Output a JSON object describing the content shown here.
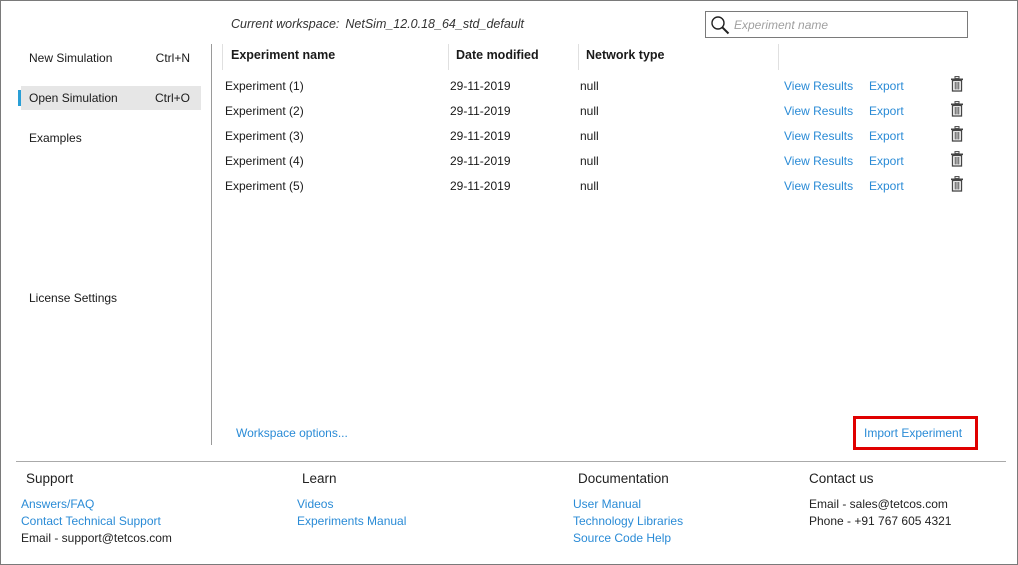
{
  "header": {
    "workspace_label": "Current workspace:",
    "workspace_name": "NetSim_12.0.18_64_std_default",
    "search_placeholder": "Experiment name",
    "search_value": ""
  },
  "sidebar": {
    "items": [
      {
        "label": "New Simulation",
        "shortcut": "Ctrl+N"
      },
      {
        "label": "Open Simulation",
        "shortcut": "Ctrl+O",
        "active": true
      },
      {
        "label": "Examples",
        "shortcut": ""
      },
      {
        "label": "License Settings",
        "shortcut": ""
      }
    ]
  },
  "table": {
    "columns": [
      "Experiment name",
      "Date modified",
      "Network type"
    ],
    "rows": [
      {
        "name": "Experiment (1)",
        "date": "29-11-2019",
        "type": "null",
        "view": "View Results",
        "export": "Export"
      },
      {
        "name": "Experiment (2)",
        "date": "29-11-2019",
        "type": "null",
        "view": "View Results",
        "export": "Export"
      },
      {
        "name": "Experiment (3)",
        "date": "29-11-2019",
        "type": "null",
        "view": "View Results",
        "export": "Export"
      },
      {
        "name": "Experiment (4)",
        "date": "29-11-2019",
        "type": "null",
        "view": "View Results",
        "export": "Export"
      },
      {
        "name": "Experiment (5)",
        "date": "29-11-2019",
        "type": "null",
        "view": "View Results",
        "export": "Export"
      }
    ]
  },
  "actions": {
    "workspace_options": "Workspace options...",
    "import_experiment": "Import Experiment"
  },
  "footer": {
    "support": {
      "title": "Support",
      "links": [
        "Answers/FAQ",
        "Contact Technical Support"
      ],
      "text": "Email - support@tetcos.com"
    },
    "learn": {
      "title": "Learn",
      "links": [
        "Videos",
        "Experiments Manual"
      ]
    },
    "documentation": {
      "title": "Documentation",
      "links": [
        "User Manual",
        "Technology Libraries",
        "Source Code Help"
      ]
    },
    "contact": {
      "title": "Contact us",
      "lines": [
        "Email - sales@tetcos.com",
        "Phone - +91 767 605 4321"
      ]
    }
  },
  "colors": {
    "link": "#2a8bd6",
    "accent": "#2a9fd6",
    "highlight_box": "#e00000"
  }
}
